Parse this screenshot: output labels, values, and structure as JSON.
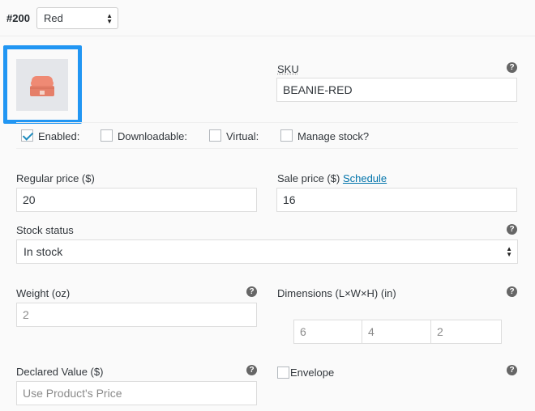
{
  "variation": {
    "number": "#200",
    "attribute_value": "Red"
  },
  "image": {
    "icon": "beanie-hat-image"
  },
  "sku": {
    "label": "SKU",
    "value": "BEANIE-RED"
  },
  "options": {
    "enabled": {
      "label": "Enabled:",
      "checked": true
    },
    "downloadable": {
      "label": "Downloadable:",
      "checked": false
    },
    "virtual": {
      "label": "Virtual:",
      "checked": false
    },
    "manage_stock": {
      "label": "Manage stock?",
      "checked": false
    }
  },
  "pricing": {
    "regular_label": "Regular price ($)",
    "regular_value": "20",
    "sale_label": "Sale price ($)",
    "schedule_link": "Schedule",
    "sale_value": "16"
  },
  "stock": {
    "label": "Stock status",
    "value": "In stock"
  },
  "shipping": {
    "weight_label": "Weight (oz)",
    "weight_placeholder": "2",
    "dimensions_label": "Dimensions (L×W×H) (in)",
    "length_placeholder": "6",
    "width_placeholder": "4",
    "height_placeholder": "2"
  },
  "customs": {
    "declared_label": "Declared Value ($)",
    "declared_placeholder": "Use Product's Price",
    "envelope_label": "Envelope"
  },
  "help_glyph": "?",
  "colors": {
    "highlight": "#2196f3",
    "link": "#0073aa",
    "check": "#1e8cbe"
  }
}
